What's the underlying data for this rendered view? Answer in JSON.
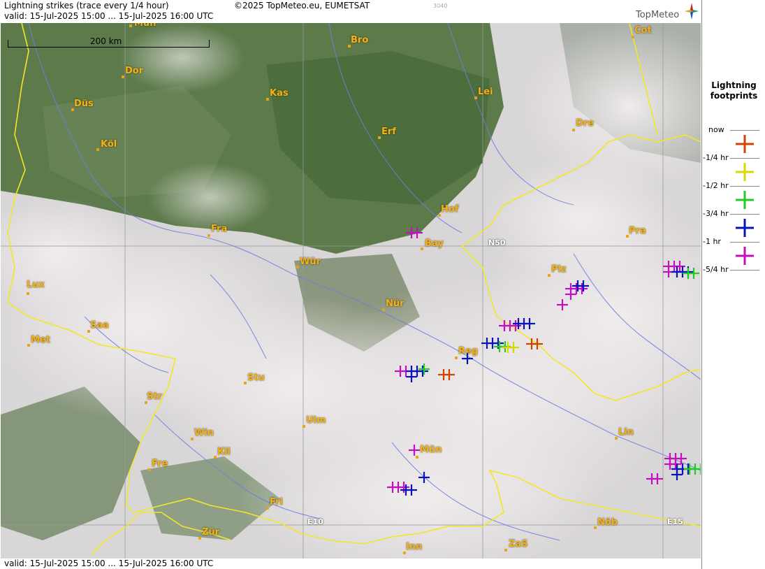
{
  "header": {
    "title": "Lightning strikes (trace every 1/4 hour)",
    "valid": "valid:  15-Jul-2025 15:00 ... 15-Jul-2025 16:00 UTC",
    "copyright": "©2025 TopMeteo.eu, EUMETSAT",
    "code": "3040",
    "brand": "TopMeteo"
  },
  "footer": {
    "valid": "valid:  15-Jul-2025 15:00 ... 15-Jul-2025 16:00 UTC"
  },
  "scalebar": {
    "label": "200 km"
  },
  "legend": {
    "title_line1": "Lightning",
    "title_line2": "footprints",
    "labels": [
      "now",
      "-1/4 hr",
      "-1/2 hr",
      "-3/4 hr",
      "-1 hr",
      "-5/4 hr"
    ],
    "colors": [
      "#cc4400",
      "#d8d800",
      "#22cc22",
      "#0a14b4",
      "#c010c0"
    ]
  },
  "grid_labels": {
    "n50": "N50",
    "e10": "E10",
    "e15": "E15"
  },
  "cities": [
    "Mün",
    "Dor",
    "Düs",
    "Köl",
    "Kas",
    "Bro",
    "Lei",
    "Cot",
    "Erf",
    "Dre",
    "Hof",
    "Bay",
    "Fra",
    "Pra",
    "Würz",
    "Plz",
    "Lux",
    "Nür",
    "Saa",
    "Met",
    "Reg",
    "Stu",
    "Str",
    "Ulm",
    "Win",
    "Kli",
    "Mün2",
    "Lin",
    "Fre",
    "Fri",
    "Zür",
    "Inn",
    "ZaS",
    "NÖb"
  ],
  "city_labels": {
    "Mün": "Mün",
    "Dor": "Dor",
    "Düs": "Düs",
    "Köl": "Köl",
    "Kas": "Kas",
    "Bro": "Bro",
    "Lei": "Lei",
    "Cot": "Cot",
    "Erf": "Erf",
    "Dre": "Dre",
    "Hof": "Hof",
    "Bay": "Bay",
    "Fra": "Fra",
    "Pra": "Pra",
    "Würz": "Wür",
    "Plz": "Plz",
    "Lux": "Lux",
    "Nür": "Nür",
    "Saa": "Saa",
    "Met": "Met",
    "Reg": "Reg",
    "Stu": "Stu",
    "Str": "Str",
    "Ulm": "Ulm",
    "Win": "Win",
    "Kli": "Kli",
    "Mün2": "Mün",
    "Lin": "Lin",
    "Fre": "Fre",
    "Fri": "Fri",
    "Zür": "Zür",
    "Inn": "Inn",
    "ZaS": "ZaS",
    "NÖb": "Nöb"
  }
}
